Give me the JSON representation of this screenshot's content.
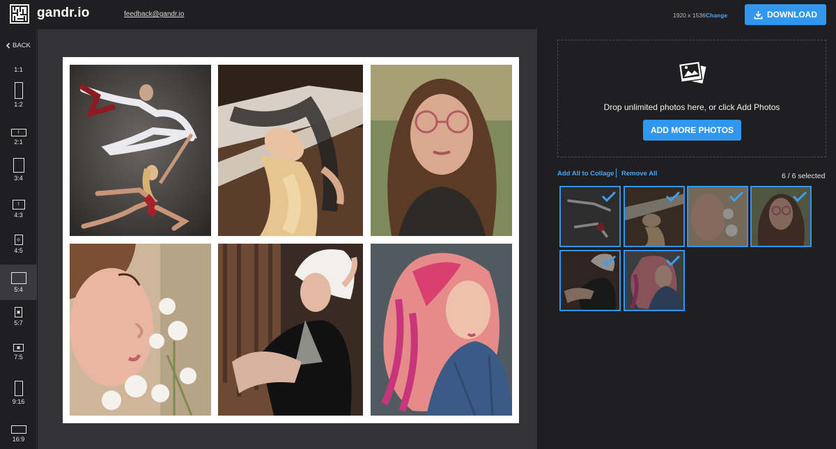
{
  "header": {
    "brand": "gandr.io",
    "feedback_email": "feedback@gandr.io",
    "dimensions": "1920 x 1536",
    "change_label": "Change",
    "download_label": "DOWNLOAD"
  },
  "sidebar": {
    "back_label": "BACK",
    "ratios": [
      {
        "label": "1:1",
        "icon": ""
      },
      {
        "label": "1:2",
        "icon": ""
      },
      {
        "label": "2:1",
        "icon": "f"
      },
      {
        "label": "3:4",
        "icon": ""
      },
      {
        "label": "4:3",
        "icon": "f"
      },
      {
        "label": "4:5",
        "icon": "◎"
      },
      {
        "label": "5:4",
        "icon": ""
      },
      {
        "label": "5:7",
        "icon": "▣"
      },
      {
        "label": "7:5",
        "icon": "▣"
      },
      {
        "label": "9:16",
        "icon": ""
      },
      {
        "label": "16:9",
        "icon": ""
      }
    ],
    "active_ratio": "5:4"
  },
  "upload": {
    "drop_text": "Drop unlimited photos here, or click Add Photos",
    "add_more_label": "ADD MORE PHOTOS",
    "add_all_label": "Add All to Collage",
    "remove_all_label": "Remove All",
    "selected_count": "6 / 6 selected"
  },
  "colors": {
    "accent": "#3196ec",
    "link": "#4aa6f2",
    "background": "#1f1f21",
    "canvas_bg": "#333336"
  },
  "photos": [
    {
      "subject": "dancers"
    },
    {
      "subject": "reclining-woman"
    },
    {
      "subject": "woman-glasses"
    },
    {
      "subject": "woman-flowers"
    },
    {
      "subject": "woman-white-hat"
    },
    {
      "subject": "woman-pink-hair"
    }
  ]
}
